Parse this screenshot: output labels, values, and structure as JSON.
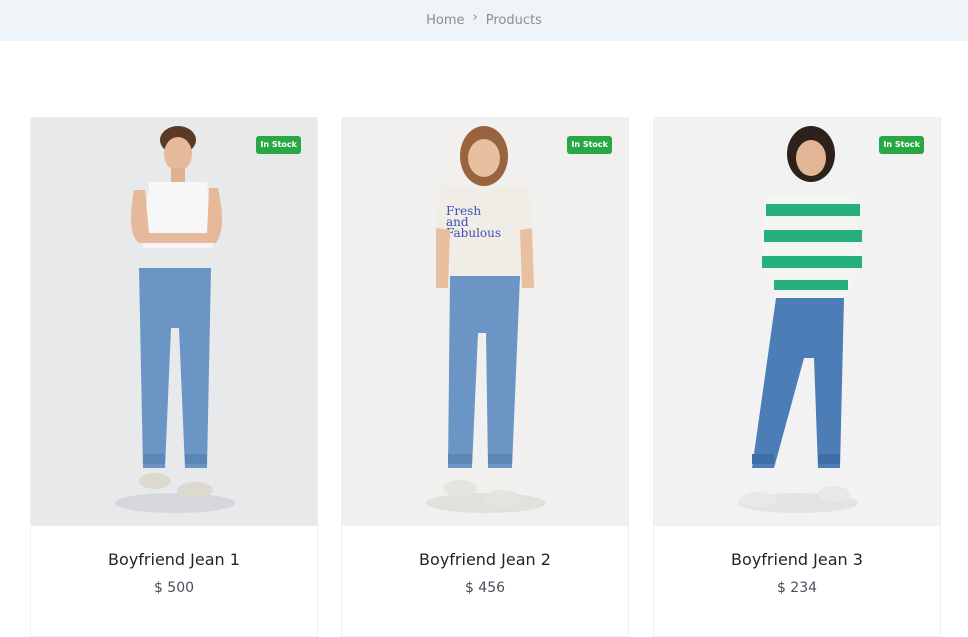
{
  "breadcrumb": {
    "home": "Home",
    "separator": "›",
    "current": "Products"
  },
  "products": [
    {
      "name": "Boyfriend Jean 1",
      "price": "$ 500",
      "badge": "In Stock",
      "top": "white-tank-top",
      "bg": "#e8e9eb"
    },
    {
      "name": "Boyfriend Jean 2",
      "price": "$ 456",
      "badge": "In Stock",
      "top": "cream-graphic-tee",
      "shirt_text": [
        "Fresh",
        "and",
        "Fabulous"
      ],
      "bg": "#f1f0ee"
    },
    {
      "name": "Boyfriend Jean 3",
      "price": "$ 234",
      "badge": "In Stock",
      "top": "green-striped-sweater",
      "bg": "#f2f2f2"
    }
  ],
  "colors": {
    "badge": "#28a745",
    "denim": "#6a95c4",
    "breadcrumb_bg": "#eff4f8"
  }
}
